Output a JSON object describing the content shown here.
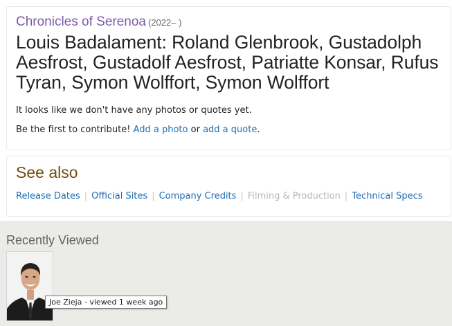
{
  "filmography": {
    "series_title": "Chronicles of Serenoa",
    "series_years": "(2022– )",
    "heading": "Louis Badalament: Roland Glenbrook, Gustadolph Aesfrost, Gustadolf Aesfrost, Patriatte Konsar, Rufus Tyran, Symon Wolffort, Symon Wolffort",
    "empty_message": "It looks like we don't have any photos or quotes yet.",
    "contribute_prefix": "Be the first to contribute!",
    "add_photo_link": "Add a photo",
    "or_text": "or",
    "add_quote_link": "add a quote",
    "period": "."
  },
  "see_also": {
    "title": "See also",
    "links": [
      {
        "label": "Release Dates",
        "enabled": true
      },
      {
        "label": "Official Sites",
        "enabled": true
      },
      {
        "label": "Company Credits",
        "enabled": true
      },
      {
        "label": "Filming & Production",
        "enabled": false
      },
      {
        "label": "Technical Specs",
        "enabled": true
      }
    ],
    "separator": "|"
  },
  "recently_viewed": {
    "title": "Recently Viewed",
    "items": [
      {
        "tooltip": "Joe Zieja - viewed 1 week ago",
        "icon": "person-photo"
      }
    ]
  },
  "colors": {
    "link": "#1f6db6",
    "series_link": "#7c5aa6",
    "see_also_title": "#6f4f0e",
    "recent_bg": "#ebebe8"
  }
}
